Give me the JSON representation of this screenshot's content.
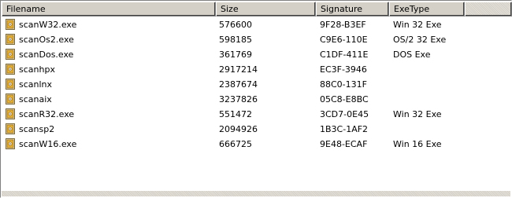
{
  "columns": {
    "filename": "Filename",
    "size": "Size",
    "signature": "Signature",
    "exetype": "ExeType"
  },
  "rows": [
    {
      "name": "scanW32.exe",
      "size": "576600",
      "signature": "9F28-B3EF",
      "type": "Win 32 Exe",
      "icon": "exe-file-icon"
    },
    {
      "name": "scanOs2.exe",
      "size": "598185",
      "signature": "C9E6-110E",
      "type": "OS/2 32 Exe",
      "icon": "exe-file-icon"
    },
    {
      "name": "scanDos.exe",
      "size": "361769",
      "signature": "C1DF-411E",
      "type": "DOS Exe",
      "icon": "exe-file-icon"
    },
    {
      "name": "scanhpx",
      "size": "2917214",
      "signature": "EC3F-3946",
      "type": "",
      "icon": "exe-file-icon"
    },
    {
      "name": "scanlnx",
      "size": "2387674",
      "signature": "88C0-131F",
      "type": "",
      "icon": "exe-file-icon"
    },
    {
      "name": "scanaix",
      "size": "3237826",
      "signature": "05C8-E8BC",
      "type": "",
      "icon": "exe-file-icon"
    },
    {
      "name": "scanR32.exe",
      "size": "551472",
      "signature": "3CD7-0E45",
      "type": "Win 32 Exe",
      "icon": "exe-file-icon"
    },
    {
      "name": "scansp2",
      "size": "2094926",
      "signature": "1B3C-1AF2",
      "type": "",
      "icon": "exe-file-icon"
    },
    {
      "name": "scanW16.exe",
      "size": "666725",
      "signature": "9E48-ECAF",
      "type": "Win 16 Exe",
      "icon": "exe-file-icon"
    }
  ]
}
